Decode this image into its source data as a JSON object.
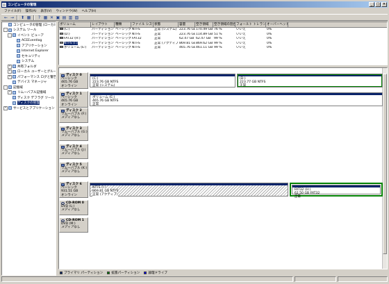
{
  "window": {
    "title": "コンピュータの管理",
    "controls": [
      "_",
      "□",
      "×"
    ]
  },
  "menu": [
    "ファイル(F)",
    "操作(A)",
    "表示(V)",
    "ウィンドウ(W)",
    "ヘルプ(H)"
  ],
  "toolbar": [
    "←",
    "→",
    "⬆",
    "▦",
    "?",
    "▦",
    "✕",
    "▣",
    "▤",
    "▥",
    "▧"
  ],
  "tree": [
    {
      "label": "コンピュータの管理 (ローカル)",
      "level": 0,
      "exp": "",
      "icon": "computer-icon"
    },
    {
      "label": "システム ツール",
      "level": 0,
      "exp": "-",
      "icon": "tools-icon"
    },
    {
      "label": "イベント ビューア",
      "level": 1,
      "exp": "-",
      "icon": "event-viewer-icon"
    },
    {
      "label": "ACEEventlog",
      "level": 2,
      "exp": "",
      "icon": "log-icon"
    },
    {
      "label": "アプリケーション",
      "level": 2,
      "exp": "",
      "icon": "log-icon"
    },
    {
      "label": "Internet Explorer",
      "level": 2,
      "exp": "",
      "icon": "log-icon"
    },
    {
      "label": "セキュリティ",
      "level": 2,
      "exp": "",
      "icon": "log-icon"
    },
    {
      "label": "システム",
      "level": 2,
      "exp": "",
      "icon": "log-icon"
    },
    {
      "label": "共有フォルダ",
      "level": 1,
      "exp": "+",
      "icon": "shared-folder-icon"
    },
    {
      "label": "ローカル ユーザーとグループ",
      "level": 1,
      "exp": "+",
      "icon": "users-icon"
    },
    {
      "label": "パフォーマンス ログと警告",
      "level": 1,
      "exp": "+",
      "icon": "performance-icon"
    },
    {
      "label": "デバイス マネージャ",
      "level": 1,
      "exp": "",
      "icon": "device-manager-icon"
    },
    {
      "label": "記憶域",
      "level": 0,
      "exp": "-",
      "icon": "storage-icon"
    },
    {
      "label": "リムーバブル記憶域",
      "level": 1,
      "exp": "+",
      "icon": "removable-storage-icon"
    },
    {
      "label": "ディスク デフラグ ツール",
      "level": 1,
      "exp": "",
      "icon": "defrag-icon"
    },
    {
      "label": "ディスクの管理",
      "level": 1,
      "exp": "",
      "icon": "disk-management-icon",
      "selected": true
    },
    {
      "label": "サービスとアプリケーション",
      "level": 0,
      "exp": "+",
      "icon": "services-icon"
    }
  ],
  "volume_list": {
    "headers": [
      "ボリューム",
      "レイアウト",
      "種類",
      "ファイル システム",
      "状態",
      "容量",
      "空き領域",
      "空き領域の割合",
      "フォールト トレランス",
      "オーバーヘッド"
    ],
    "rows": [
      [
        "(C:)",
        "パーティション",
        "ベーシック",
        "NTFS",
        "正常 (システム)",
        "223.76 GB",
        "170.49 GB",
        "76 %",
        "いいえ",
        "0%"
      ],
      [
        "(D:)",
        "パーティション",
        "ベーシック",
        "NTFS",
        "正常",
        "223.76 GB",
        "114.89 GB",
        "51 %",
        "いいえ",
        "0%"
      ],
      [
        "FAT32 (H:)",
        "パーティション",
        "ベーシック",
        "FAT32",
        "正常",
        "62.47 GB",
        "62.47 GB",
        "99 %",
        "いいえ",
        "0%"
      ],
      [
        "NTFS (I:)",
        "パーティション",
        "ベーシック",
        "NTFS",
        "正常 (アクティブ)",
        "869.81 GB",
        "869.62 GB",
        "99 %",
        "いいえ",
        "0%"
      ],
      [
        "ボリューム (E:)",
        "パーティション",
        "ベーシック",
        "NTFS",
        "正常",
        "465.76 GB",
        "461.11 GB",
        "99 %",
        "いいえ",
        "0%"
      ]
    ],
    "selected_row": 3
  },
  "disks": [
    {
      "name": "ディスク 0",
      "lines": [
        "ベーシック",
        "465.76 GB",
        "オンライン"
      ],
      "partitions": [
        {
          "label": "(C:)",
          "info": "223.76 GB NTFS",
          "status": "正常 (システム)",
          "w": 1
        },
        {
          "label": "(D:)",
          "info": "223.77 GB NTFS",
          "status": "正常",
          "w": 1,
          "selected": true
        }
      ]
    },
    {
      "name": "ディスク 1",
      "lines": [
        "ベーシック",
        "465.76 GB",
        "オンライン"
      ],
      "partitions": [
        {
          "label": "ボリューム (E:)",
          "info": "465.76 GB NTFS",
          "status": "正常",
          "w": 1
        }
      ]
    },
    {
      "name": "ディスク 2",
      "lines": [
        "リムーバブル (F:)",
        "",
        "メディアなし"
      ],
      "partitions": []
    },
    {
      "name": "ディスク 3",
      "lines": [
        "リムーバブル (G:)",
        "",
        "メディアなし"
      ],
      "partitions": []
    },
    {
      "name": "ディスク 4",
      "lines": [
        "リムーバブル (J:)",
        "",
        "メディアなし"
      ],
      "partitions": []
    },
    {
      "name": "ディスク 5",
      "lines": [
        "リムーバブル (K:)",
        "",
        "メディアなし"
      ],
      "partitions": []
    },
    {
      "name": "ディスク 6",
      "lines": [
        "ベーシック",
        "931.51 GB",
        "オンライン"
      ],
      "partitions": [
        {
          "label": "NTFS (I:)",
          "info": "869.81 GB NTFS",
          "status": "正常 (アクティブ)",
          "w": 3.1,
          "hatch": true
        },
        {
          "label": "FAT32 (H:)",
          "info": "62.50 GB FAT32",
          "status": "正常",
          "w": 1.4,
          "extended": true
        }
      ]
    },
    {
      "name": "CD-ROM 0",
      "lines": [
        "DVD (L:)",
        "",
        "メディアなし"
      ],
      "partitions": [],
      "cd": true
    },
    {
      "name": "CD-ROM 1",
      "lines": [
        "DVD (M:)",
        "",
        "メディアなし"
      ],
      "partitions": [],
      "cd": true
    }
  ],
  "legend": [
    {
      "label": "プライマリ パーティション",
      "color": "#0a246a"
    },
    {
      "label": "拡張パーティション",
      "color": "#008000"
    },
    {
      "label": "論理ドライブ",
      "color": "#0000ff"
    }
  ]
}
